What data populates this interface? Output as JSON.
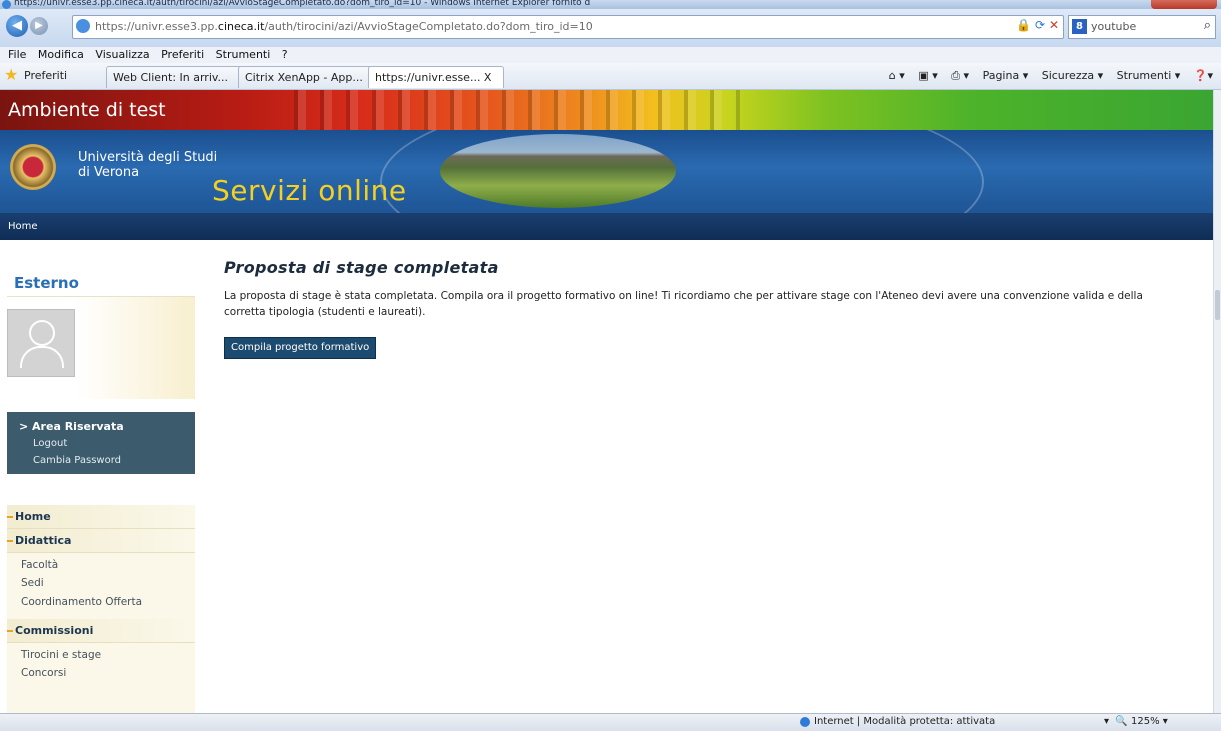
{
  "window": {
    "title": "https://univr.esse3.pp.cineca.it/auth/tirocini/azi/AvvioStageCompletato.do?dom_tiro_id=10 - Windows Internet Explorer fornito d"
  },
  "address": {
    "url_prefix": "https://univr.esse3.pp.",
    "url_host": "cineca.it",
    "url_path": "/auth/tirocini/azi/AvvioStageCompletato.do?dom_tiro_id=10"
  },
  "search": {
    "value": "youtube",
    "engine_icon": "8"
  },
  "menu": [
    "File",
    "Modifica",
    "Visualizza",
    "Preferiti",
    "Strumenti",
    "?"
  ],
  "favorites": {
    "label": "Preferiti",
    "tabs": [
      "Web Client: In arriv...",
      "Citrix XenApp - App...",
      "https://univr.esse... X"
    ]
  },
  "commands": [
    "Pagina ▾",
    "Sicurezza ▾",
    "Strumenti ▾"
  ],
  "site": {
    "env_label": "Ambiente di test",
    "university": [
      "Università degli Studi",
      "di Verona"
    ],
    "service_title": "Servizi online",
    "nav_home": "Home"
  },
  "sidebar": {
    "user_title": "Esterno",
    "reserved": {
      "heading": "> Area Riservata",
      "links": [
        "Logout",
        "Cambia Password"
      ]
    },
    "sections": [
      {
        "label": "Home"
      },
      {
        "label": "Didattica",
        "items": [
          "Facoltà",
          "Sedi",
          "Coordinamento Offerta"
        ]
      },
      {
        "label": "Commissioni",
        "items": [
          "Tirocini e stage",
          "Concorsi"
        ]
      }
    ]
  },
  "main": {
    "title": "Proposta di stage completata",
    "message": "La proposta di stage è stata completata. Compila ora il progetto formativo on line! Ti ricordiamo che per attivare stage con l'Ateneo devi avere una convenzione valida e della corretta tipologia (studenti e laureati).",
    "button": "Compila progetto formativo"
  },
  "status": {
    "zone": "Internet | Modalità protetta: attivata",
    "zoom": "125%"
  }
}
